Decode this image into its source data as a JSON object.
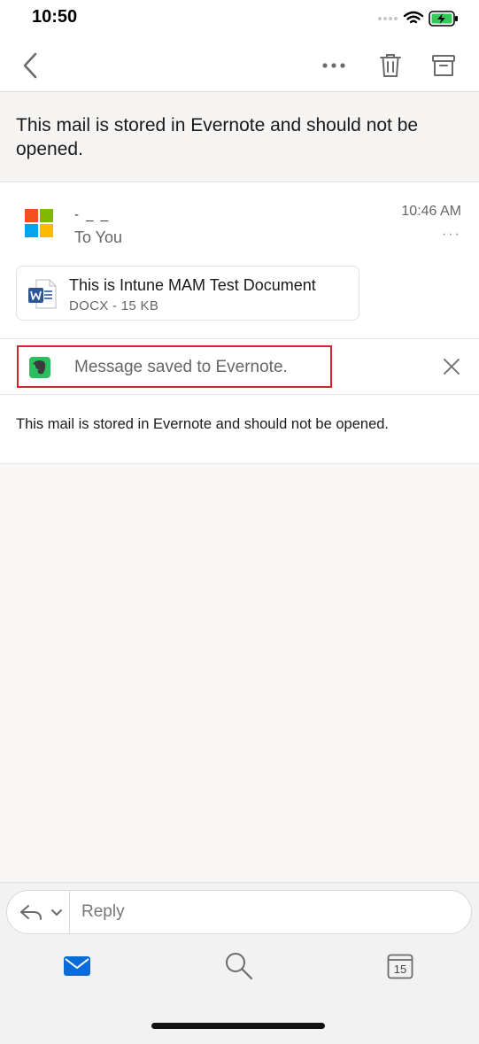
{
  "status": {
    "time": "10:50"
  },
  "nav": {
    "back_icon": "chevron-left-icon",
    "more_icon": "more-horizontal-icon",
    "delete_icon": "trash-icon",
    "archive_icon": "archive-icon"
  },
  "subject": "This mail is stored in Evernote and should not be opened.",
  "message": {
    "sender_name": "-  _  _",
    "recipient_label": "To You",
    "time": "10:46 AM",
    "more": "···",
    "attachment": {
      "name": "This is Intune MAM Test Document",
      "meta": "DOCX - 15 KB"
    },
    "banner": {
      "text": "Message saved to Evernote."
    },
    "body": "This mail is stored in Evernote and should not be opened."
  },
  "reply": {
    "placeholder": "Reply"
  },
  "tabs": {
    "calendar_day": "15"
  },
  "colors": {
    "accent": "#0a6dd6",
    "highlight": "#d0262c",
    "evernote": "#2dbe60",
    "word": "#2b5797"
  }
}
